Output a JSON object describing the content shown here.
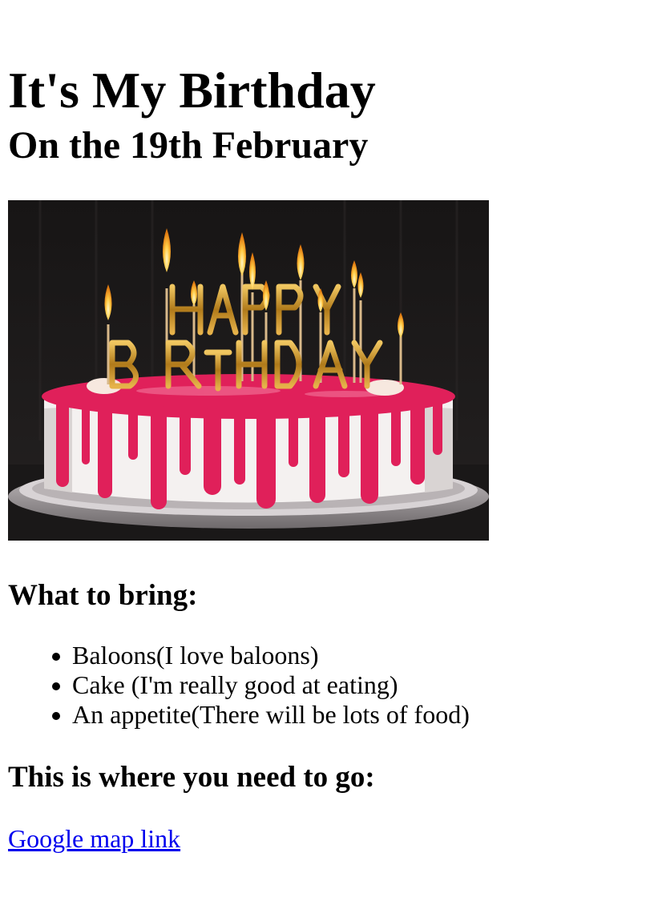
{
  "page": {
    "title": "It's My Birthday",
    "subtitle": "On the 19th February"
  },
  "photo": {
    "alt": "Birthday cake with candles",
    "topper_line1": "HAPPY",
    "topper_line2": "BIRTHDAY",
    "colors": {
      "background": "#1c1a1a",
      "frosting": "#f4f1f0",
      "drip": "#e0205a",
      "plate": "#a8a2a4",
      "gold": "#c9962e",
      "flame": "#ffcb45"
    }
  },
  "bring": {
    "heading": "What to bring:",
    "items": [
      "Baloons(I love baloons)",
      "Cake (I'm really good at eating)",
      "An appetite(There will be lots of food)"
    ]
  },
  "directions": {
    "heading": "This is where you need to go:",
    "link_label": "Google map link",
    "link_color": "#0000ee"
  }
}
